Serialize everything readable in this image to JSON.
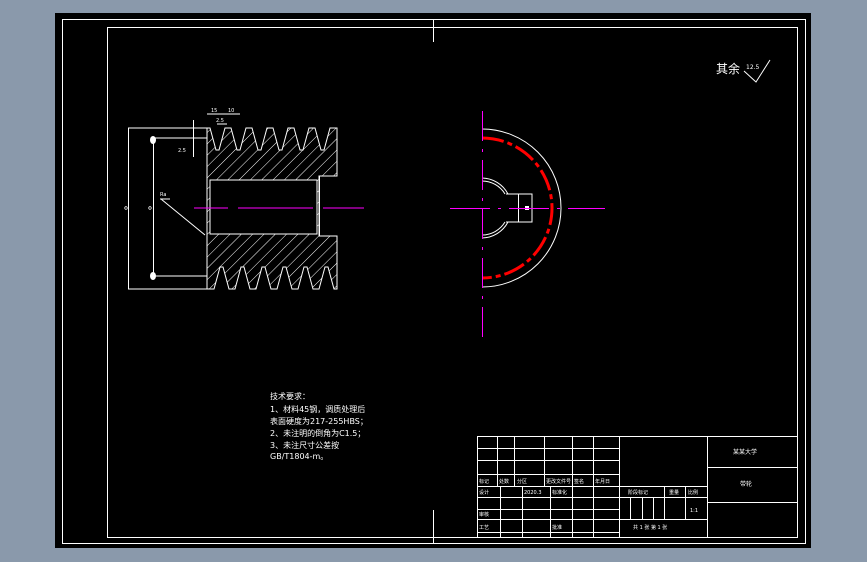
{
  "drawing": {
    "roughness_note": "其余",
    "roughness_value": "12.5",
    "left_view": {
      "dim_pitch": "15",
      "dim_groove": "10",
      "dim_top": "2.5",
      "dim_depth": "2.5",
      "dim_outer": "Φ",
      "dim_inner": "Φ",
      "leader_label": "Ra"
    },
    "tech_requirements": {
      "title": "技术要求：",
      "lines": [
        "1、材料45钢，调质处理后",
        "表面硬度为217-255HBS；",
        "2、未注明的倒角为C1.5；",
        "3、未注尺寸公差按",
        "GB/T1804-m。"
      ]
    },
    "title_block": {
      "school": "某某大学",
      "part_name": "带轮",
      "headers": [
        "标记",
        "处数",
        "分区",
        "更改文件号",
        "签名",
        "年月日"
      ],
      "row_design": [
        "设计",
        "",
        "2020.3",
        "标准化"
      ],
      "stage": "阶段标记",
      "weight": "重量",
      "scale": "比例",
      "scale_value": "1:1",
      "review": "审核",
      "process": "工艺",
      "approve": "批准",
      "sheets": "共 1 张  第 1 张"
    },
    "colors": {
      "background": "#8a99ab",
      "paper": "#000000",
      "line": "#ffffff",
      "center": "#ff00ff",
      "pitch": "#ff0000"
    }
  }
}
